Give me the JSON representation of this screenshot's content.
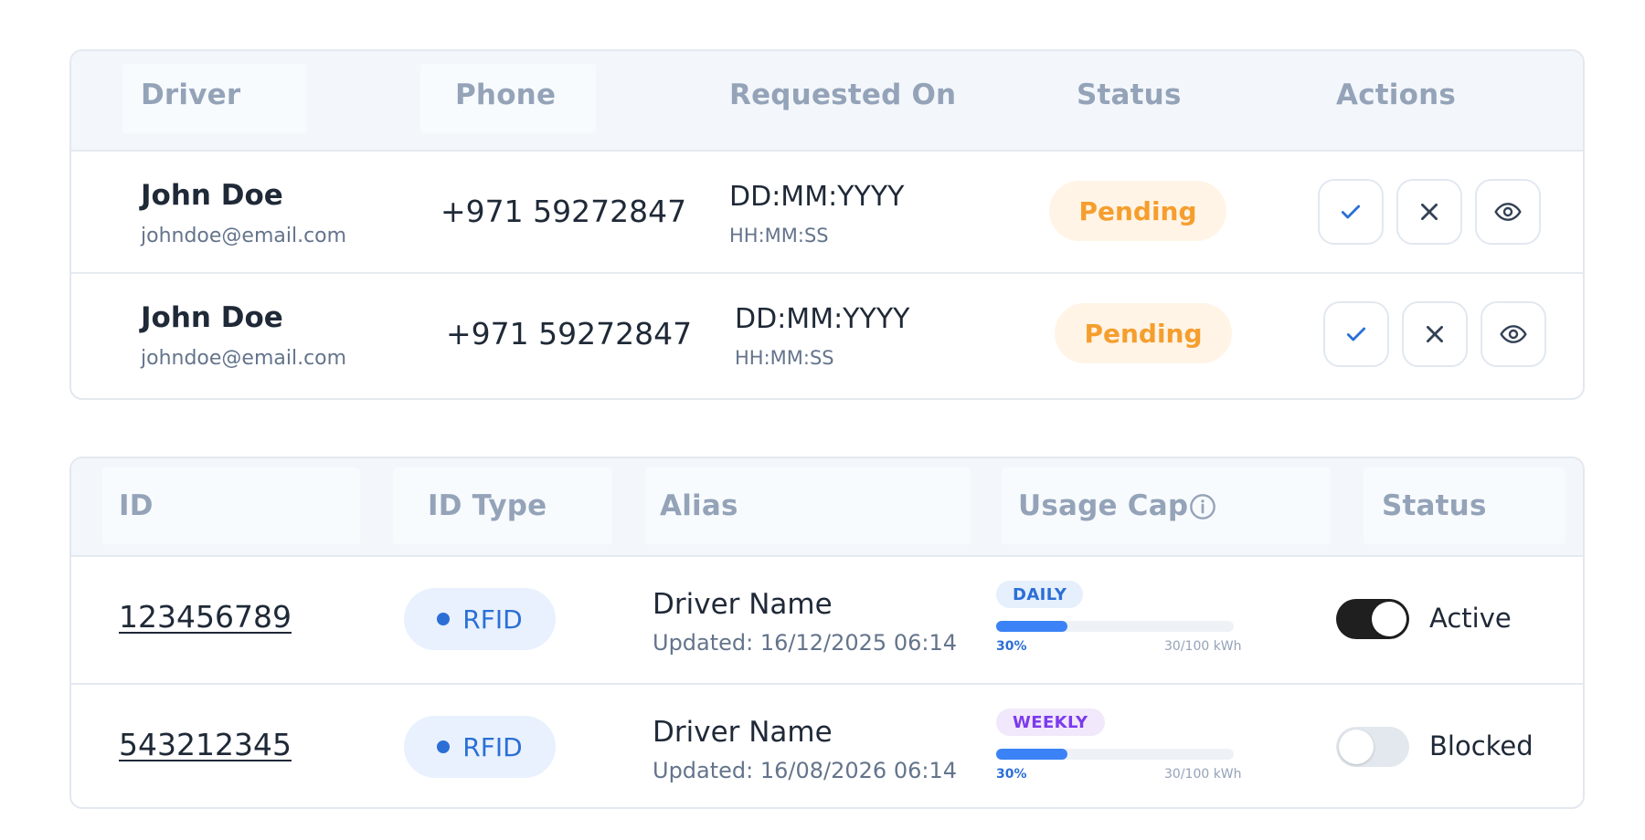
{
  "requests_table": {
    "headers": {
      "driver": "Driver",
      "phone": "Phone",
      "requested_on": "Requested On",
      "status": "Status",
      "actions": "Actions"
    },
    "rows": [
      {
        "name": "John Doe",
        "email": "johndoe@email.com",
        "phone": "+971 59272847",
        "date": "DD:MM:YYYY",
        "time": "HH:MM:SS",
        "status": "Pending",
        "actions": [
          "check-icon",
          "close-icon",
          "eye-icon"
        ]
      },
      {
        "name": "John Doe",
        "email": "johndoe@email.com",
        "phone": "+971 59272847",
        "date": "DD:MM:YYYY",
        "time": "HH:MM:SS",
        "status": "Pending",
        "actions": [
          "check-icon",
          "close-icon",
          "eye-icon"
        ]
      }
    ]
  },
  "ids_table": {
    "headers": {
      "id": "ID",
      "id_type": "ID Type",
      "alias": "Alias",
      "usage_cap": "Usage Cap",
      "usage_cap_icon": "info-icon",
      "status": "Status"
    },
    "rows": [
      {
        "id": "123456789",
        "id_type": "RFID",
        "alias": "Driver Name",
        "updated": "Updated: 16/12/2025 06:14",
        "cap_period": "DAILY",
        "cap_percent_label": "30%",
        "cap_percent": 30,
        "cap_usage": "30/100 kWh",
        "status": "Active",
        "toggle_on": true
      },
      {
        "id": "543212345",
        "id_type": "RFID",
        "alias": "Driver Name",
        "updated": "Updated: 16/08/2026 06:14",
        "cap_period": "WEEKLY",
        "cap_percent_label": "30%",
        "cap_percent": 30,
        "cap_usage": "30/100 kWh",
        "status": "Blocked",
        "toggle_on": false
      }
    ]
  },
  "colors": {
    "pending_bg": "#fff4e6",
    "pending_text": "#f59e2e",
    "rfid_bg": "#e8f1fd",
    "rfid_text": "#2b6fd6",
    "daily_text": "#2b6fd6",
    "weekly_text": "#7c3aed",
    "progress": "#3b82f6",
    "toggle_on": "#1f1f1f"
  }
}
